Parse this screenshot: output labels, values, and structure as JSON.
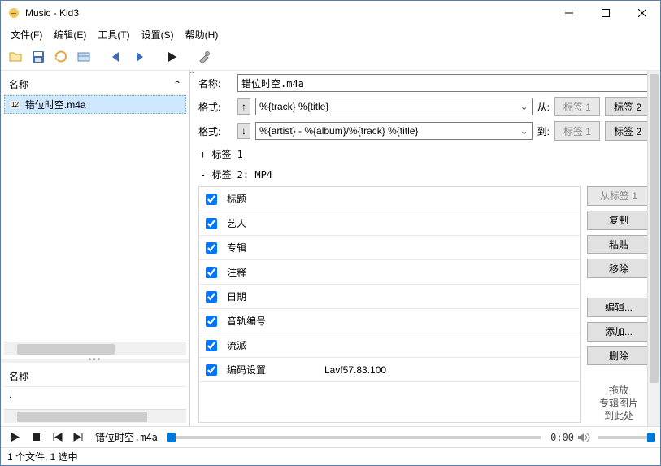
{
  "window": {
    "title": "Music - Kid3"
  },
  "menu": {
    "file": "文件(F)",
    "edit": "编辑(E)",
    "tools": "工具(T)",
    "settings": "设置(S)",
    "help": "帮助(H)"
  },
  "left": {
    "header": "名称",
    "files": [
      {
        "badge": "12",
        "name": "错位时空.m4a",
        "selected": true
      }
    ],
    "bottom_header": "名称",
    "bottom_items": [
      ".",
      ".."
    ]
  },
  "right": {
    "name_label": "名称:",
    "name_value": "错位时空.m4a",
    "format_label": "格式:",
    "format_up": "%{track} %{title}",
    "format_down": "%{artist} - %{album}/%{track} %{title}",
    "from_label": "从:",
    "to_label": "到:",
    "tag1_btn": "标签 1",
    "tag2_btn": "标签 2",
    "tag1_header": "+ 标签 1",
    "tag2_header": "- 标签 2: MP4",
    "fields": [
      {
        "name": "标题",
        "value": "",
        "checked": true
      },
      {
        "name": "艺人",
        "value": "",
        "checked": true
      },
      {
        "name": "专辑",
        "value": "",
        "checked": true
      },
      {
        "name": "注释",
        "value": "",
        "checked": true
      },
      {
        "name": "日期",
        "value": "",
        "checked": true
      },
      {
        "name": "音轨编号",
        "value": "",
        "checked": true
      },
      {
        "name": "流派",
        "value": "",
        "checked": true
      },
      {
        "name": "编码设置",
        "value": "Lavf57.83.100",
        "checked": true
      }
    ],
    "buttons": {
      "from_tag1": "从标签 1",
      "copy": "复制",
      "paste": "粘贴",
      "remove": "移除",
      "edit": "编辑...",
      "add": "添加...",
      "delete": "删除"
    },
    "dropzone": {
      "l1": "拖放",
      "l2": "专辑图片",
      "l3": "到此处"
    }
  },
  "player": {
    "track": "错位时空.m4a",
    "time": "0:00"
  },
  "status": {
    "text": "1 个文件, 1 选中"
  }
}
